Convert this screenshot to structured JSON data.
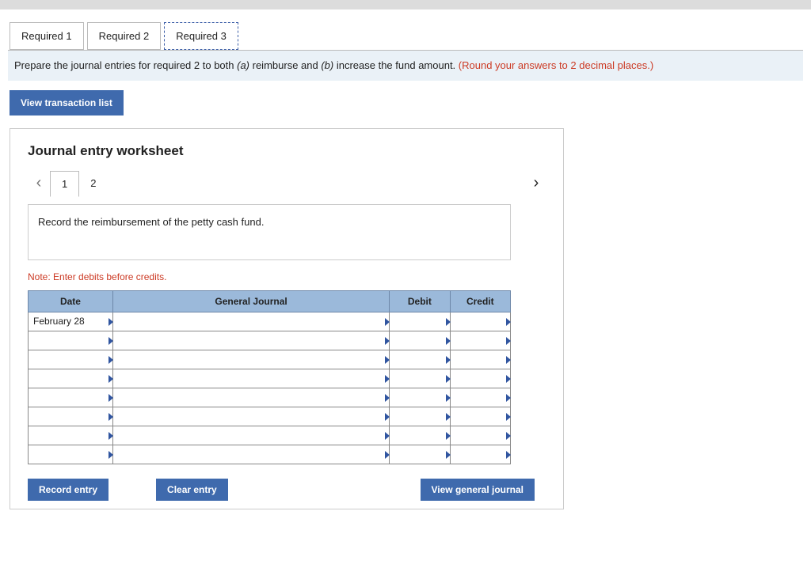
{
  "tabs": {
    "t1": "Required 1",
    "t2": "Required 2",
    "t3": "Required 3"
  },
  "instruction": {
    "pre": "Prepare the journal entries for required 2 to both ",
    "a": "(a)",
    "mid1": " reimburse and ",
    "b": "(b)",
    "mid2": " increase the fund amount. ",
    "note": "(Round your answers to 2 decimal places.)"
  },
  "buttons": {
    "view_trans": "View transaction list",
    "record": "Record entry",
    "clear": "Clear entry",
    "view_gj": "View general journal"
  },
  "worksheet": {
    "title": "Journal entry worksheet",
    "mini_tabs": {
      "t1": "1",
      "t2": "2"
    },
    "prompt": "Record the reimbursement of the petty cash fund.",
    "note": "Note: Enter debits before credits.",
    "headers": {
      "date": "Date",
      "gj": "General Journal",
      "debit": "Debit",
      "credit": "Credit"
    },
    "rows": [
      {
        "date": "February 28",
        "gj": "",
        "debit": "",
        "credit": ""
      },
      {
        "date": "",
        "gj": "",
        "debit": "",
        "credit": ""
      },
      {
        "date": "",
        "gj": "",
        "debit": "",
        "credit": ""
      },
      {
        "date": "",
        "gj": "",
        "debit": "",
        "credit": ""
      },
      {
        "date": "",
        "gj": "",
        "debit": "",
        "credit": ""
      },
      {
        "date": "",
        "gj": "",
        "debit": "",
        "credit": ""
      },
      {
        "date": "",
        "gj": "",
        "debit": "",
        "credit": ""
      },
      {
        "date": "",
        "gj": "",
        "debit": "",
        "credit": ""
      }
    ]
  }
}
